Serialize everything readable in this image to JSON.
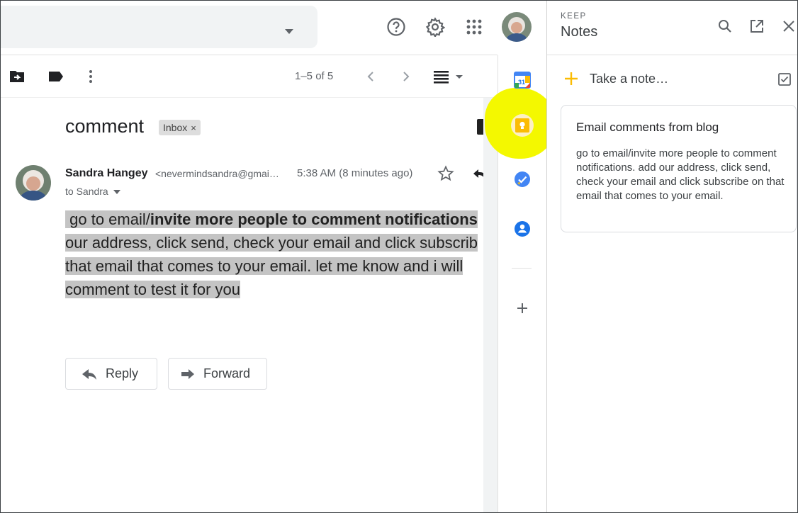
{
  "toolbar": {
    "pager_text": "1–5 of 5"
  },
  "message": {
    "subject": "comment",
    "label_chip": "Inbox",
    "label_remove": "×",
    "sender_name": "Sandra Hangey",
    "sender_email": "<nevermindsandra@gmai…",
    "time": "5:38 AM (8 minutes ago)",
    "to_line": "to Sandra",
    "body": {
      "line1_a": "go to email/",
      "line1_b": "invite more people to comment notifications",
      "line2": "our address, click send, check your email and click subscrib",
      "line3": "that email that comes to your email. let me know and i will",
      "line4": "comment to test it for you"
    },
    "reply_label": "Reply",
    "forward_label": "Forward"
  },
  "side_rail": {
    "calendar_day": "31",
    "highlight_color": "#f4f800"
  },
  "keep": {
    "label": "KEEP",
    "title": "Notes",
    "take_note": "Take a note…",
    "note_title": "Email comments from blog",
    "note_body": "go to email/invite more people to comment notifications. add our address, click send, check your email and click subscribe on that email that comes to your email."
  },
  "colors": {
    "accent_keep": "#fbbc04",
    "tasks_blue": "#4285f4",
    "contacts_blue": "#1a73e8"
  }
}
